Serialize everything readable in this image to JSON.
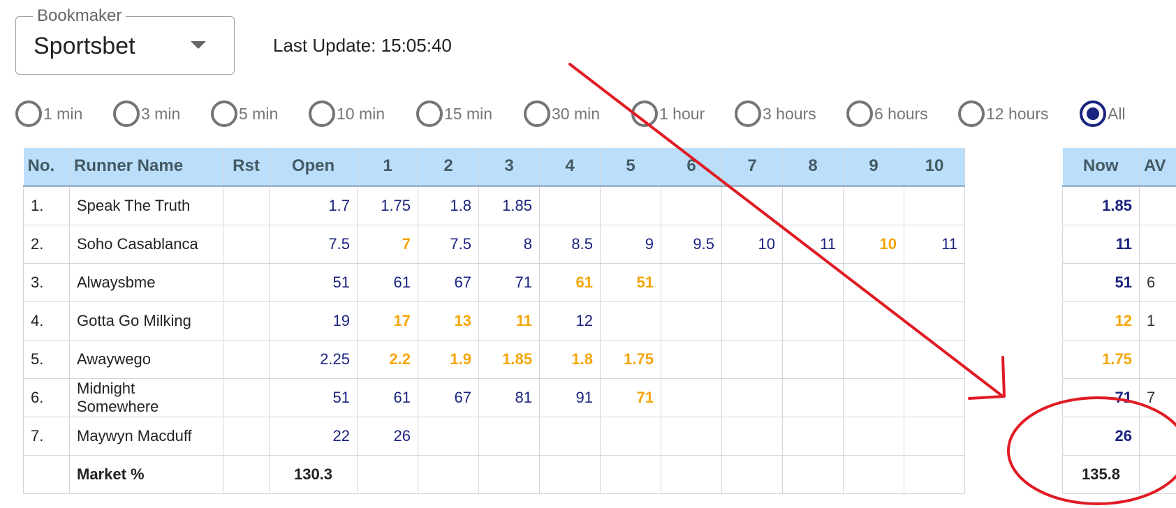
{
  "bookmaker": {
    "legend": "Bookmaker",
    "value": "Sportsbet"
  },
  "last_update": "Last Update: 15:05:40",
  "time_filters": {
    "options": [
      "1 min",
      "3 min",
      "5 min",
      "10 min",
      "15 min",
      "30 min",
      "1 hour",
      "3 hours",
      "6 hours",
      "12 hours",
      "All"
    ],
    "selected": "All"
  },
  "colors": {
    "header_bg": "#bbdefb",
    "odds_blue": "#1a237e",
    "odds_shortening": "#f5a60b",
    "annotation_red": "#e01b24"
  },
  "table": {
    "headers": [
      "No.",
      "Runner Name",
      "Rst",
      "Open",
      "1",
      "2",
      "3",
      "4",
      "5",
      "6",
      "7",
      "8",
      "9",
      "10"
    ],
    "rows": [
      {
        "no": "1.",
        "name": "Speak The Truth",
        "rst": "",
        "open": "1.7",
        "moves": [
          {
            "v": "1.75",
            "up": false
          },
          {
            "v": "1.8",
            "up": false
          },
          {
            "v": "1.85",
            "up": false
          },
          {
            "v": "",
            "up": false
          },
          {
            "v": "",
            "up": false
          },
          {
            "v": "",
            "up": false
          },
          {
            "v": "",
            "up": false
          },
          {
            "v": "",
            "up": false
          },
          {
            "v": "",
            "up": false
          },
          {
            "v": "",
            "up": false
          }
        ]
      },
      {
        "no": "2.",
        "name": "Soho Casablanca",
        "rst": "",
        "open": "7.5",
        "moves": [
          {
            "v": "7",
            "up": true
          },
          {
            "v": "7.5",
            "up": false
          },
          {
            "v": "8",
            "up": false
          },
          {
            "v": "8.5",
            "up": false
          },
          {
            "v": "9",
            "up": false
          },
          {
            "v": "9.5",
            "up": false
          },
          {
            "v": "10",
            "up": false
          },
          {
            "v": "11",
            "up": false
          },
          {
            "v": "10",
            "up": true
          },
          {
            "v": "11",
            "up": false
          }
        ]
      },
      {
        "no": "3.",
        "name": "Alwaysbme",
        "rst": "",
        "open": "51",
        "moves": [
          {
            "v": "61",
            "up": false
          },
          {
            "v": "67",
            "up": false
          },
          {
            "v": "71",
            "up": false
          },
          {
            "v": "61",
            "up": true
          },
          {
            "v": "51",
            "up": true
          },
          {
            "v": "",
            "up": false
          },
          {
            "v": "",
            "up": false
          },
          {
            "v": "",
            "up": false
          },
          {
            "v": "",
            "up": false
          },
          {
            "v": "",
            "up": false
          }
        ]
      },
      {
        "no": "4.",
        "name": "Gotta Go Milking",
        "rst": "",
        "open": "19",
        "moves": [
          {
            "v": "17",
            "up": true
          },
          {
            "v": "13",
            "up": true
          },
          {
            "v": "11",
            "up": true
          },
          {
            "v": "12",
            "up": false
          },
          {
            "v": "",
            "up": false
          },
          {
            "v": "",
            "up": false
          },
          {
            "v": "",
            "up": false
          },
          {
            "v": "",
            "up": false
          },
          {
            "v": "",
            "up": false
          },
          {
            "v": "",
            "up": false
          }
        ]
      },
      {
        "no": "5.",
        "name": "Awaywego",
        "rst": "",
        "open": "2.25",
        "moves": [
          {
            "v": "2.2",
            "up": true
          },
          {
            "v": "1.9",
            "up": true
          },
          {
            "v": "1.85",
            "up": true
          },
          {
            "v": "1.8",
            "up": true
          },
          {
            "v": "1.75",
            "up": true
          },
          {
            "v": "",
            "up": false
          },
          {
            "v": "",
            "up": false
          },
          {
            "v": "",
            "up": false
          },
          {
            "v": "",
            "up": false
          },
          {
            "v": "",
            "up": false
          }
        ]
      },
      {
        "no": "6.",
        "name": "Midnight Somewhere",
        "rst": "",
        "open": "51",
        "moves": [
          {
            "v": "61",
            "up": false
          },
          {
            "v": "67",
            "up": false
          },
          {
            "v": "81",
            "up": false
          },
          {
            "v": "91",
            "up": false
          },
          {
            "v": "71",
            "up": true
          },
          {
            "v": "",
            "up": false
          },
          {
            "v": "",
            "up": false
          },
          {
            "v": "",
            "up": false
          },
          {
            "v": "",
            "up": false
          },
          {
            "v": "",
            "up": false
          }
        ]
      },
      {
        "no": "7.",
        "name": "Maywyn Macduff",
        "rst": "",
        "open": "22",
        "moves": [
          {
            "v": "26",
            "up": false
          },
          {
            "v": "",
            "up": false
          },
          {
            "v": "",
            "up": false
          },
          {
            "v": "",
            "up": false
          },
          {
            "v": "",
            "up": false
          },
          {
            "v": "",
            "up": false
          },
          {
            "v": "",
            "up": false
          },
          {
            "v": "",
            "up": false
          },
          {
            "v": "",
            "up": false
          },
          {
            "v": "",
            "up": false
          }
        ]
      }
    ],
    "market": {
      "label": "Market %",
      "open": "130.3"
    }
  },
  "now_table": {
    "headers": [
      "Now",
      "AV"
    ],
    "rows": [
      {
        "now": "1.85",
        "up": false,
        "av": ""
      },
      {
        "now": "11",
        "up": false,
        "av": ""
      },
      {
        "now": "51",
        "up": false,
        "av": "6"
      },
      {
        "now": "12",
        "up": true,
        "av": "1"
      },
      {
        "now": "1.75",
        "up": true,
        "av": ""
      },
      {
        "now": "71",
        "up": false,
        "av": "7"
      },
      {
        "now": "26",
        "up": false,
        "av": ""
      }
    ],
    "market": "135.8"
  }
}
